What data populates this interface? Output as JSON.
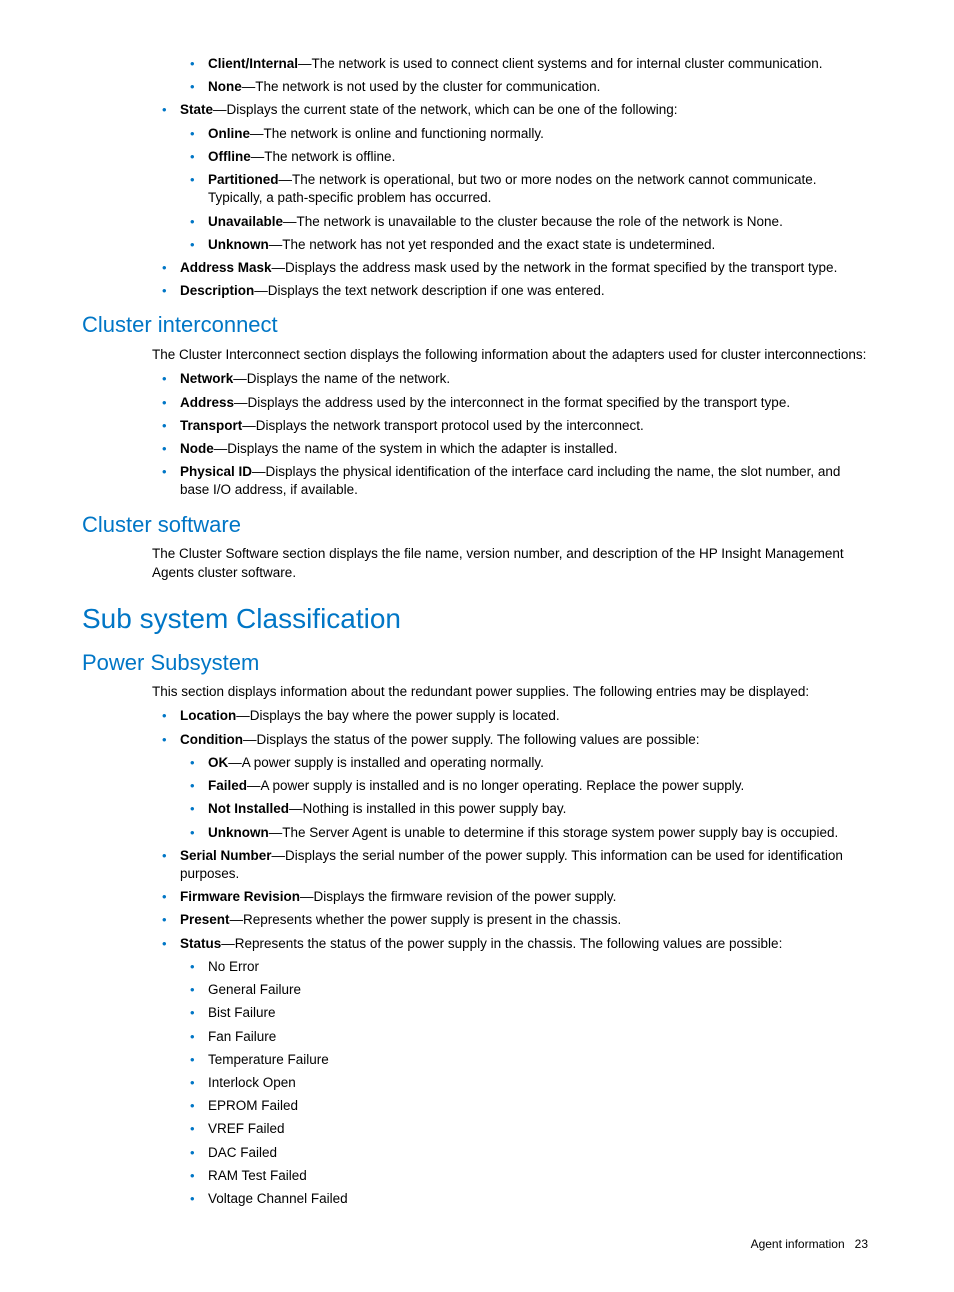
{
  "top_continuation": {
    "client_internal": {
      "term": "Client/Internal",
      "desc": "—The network is used to connect client systems and for internal cluster communication."
    },
    "none": {
      "term": "None",
      "desc": "—The network is not used by the cluster for communication."
    },
    "state": {
      "term": "State",
      "desc": "—Displays the current state of the network, which can be one of the following:"
    },
    "state_items": {
      "online": {
        "term": "Online",
        "desc": "—The network is online and functioning normally."
      },
      "offline": {
        "term": "Offline",
        "desc": "—The network is offline."
      },
      "partitioned": {
        "term": "Partitioned",
        "desc": "—The network is operational, but two or more nodes on the network cannot communicate. Typically, a path-specific problem has occurred."
      },
      "unavailable": {
        "term": "Unavailable",
        "desc": "—The network is unavailable to the cluster because the role of the network is None."
      },
      "unknown": {
        "term": "Unknown",
        "desc": "—The network has not yet responded and the exact state is undetermined."
      }
    },
    "address_mask": {
      "term": "Address Mask",
      "desc": "—Displays the address mask used by the network in the format specified by the transport type."
    },
    "description": {
      "term": "Description",
      "desc": "—Displays the text network description if one was entered."
    }
  },
  "cluster_interconnect": {
    "heading": "Cluster interconnect",
    "intro": "The Cluster Interconnect section displays the following information about the adapters used for cluster interconnections:",
    "items": {
      "network": {
        "term": "Network",
        "desc": "—Displays the name of the network."
      },
      "address": {
        "term": "Address",
        "desc": "—Displays the address used by the interconnect in the format specified by the transport type."
      },
      "transport": {
        "term": "Transport",
        "desc": "—Displays the network transport protocol used by the interconnect."
      },
      "node": {
        "term": "Node",
        "desc": "—Displays the name of the system in which the adapter is installed."
      },
      "physical_id": {
        "term": "Physical ID",
        "desc": "—Displays the physical identification of the interface card including the name, the slot number, and base I/O address, if available."
      }
    }
  },
  "cluster_software": {
    "heading": "Cluster software",
    "intro": "The Cluster Software section displays the file name, version number, and description of the HP Insight Management Agents cluster software."
  },
  "subsystem": {
    "heading": "Sub system Classification"
  },
  "power": {
    "heading": "Power Subsystem",
    "intro": "This section displays information about the redundant power supplies. The following entries may be displayed:",
    "items": {
      "location": {
        "term": "Location",
        "desc": "—Displays the bay where the power supply is located."
      },
      "condition": {
        "term": "Condition",
        "desc": "—Displays the status of the power supply. The following values are possible:"
      },
      "condition_vals": {
        "ok": {
          "term": "OK",
          "desc": "—A power supply is installed and operating normally."
        },
        "failed": {
          "term": "Failed",
          "desc": "—A power supply is installed and is no longer operating. Replace the power supply."
        },
        "not_installed": {
          "term": "Not Installed",
          "desc": "—Nothing is installed in this power supply bay."
        },
        "unknown": {
          "term": "Unknown",
          "desc": "—The Server Agent is unable to determine if this storage system power supply bay is occupied."
        }
      },
      "serial": {
        "term": "Serial Number",
        "desc": "—Displays the serial number of the power supply. This information can be used for identification purposes."
      },
      "firmware": {
        "term": "Firmware Revision",
        "desc": "—Displays the firmware revision of the power supply."
      },
      "present": {
        "term": "Present",
        "desc": "—Represents whether the power supply is present in the chassis."
      },
      "status": {
        "term": "Status",
        "desc": "—Represents the status of the power supply in the chassis. The following values are possible:"
      },
      "status_vals": {
        "v0": "No Error",
        "v1": "General Failure",
        "v2": "Bist Failure",
        "v3": "Fan Failure",
        "v4": "Temperature Failure",
        "v5": "Interlock Open",
        "v6": "EPROM Failed",
        "v7": "VREF Failed",
        "v8": "DAC Failed",
        "v9": "RAM Test Failed",
        "v10": "Voltage Channel Failed"
      }
    }
  },
  "footer": {
    "label": "Agent information",
    "page": "23"
  }
}
